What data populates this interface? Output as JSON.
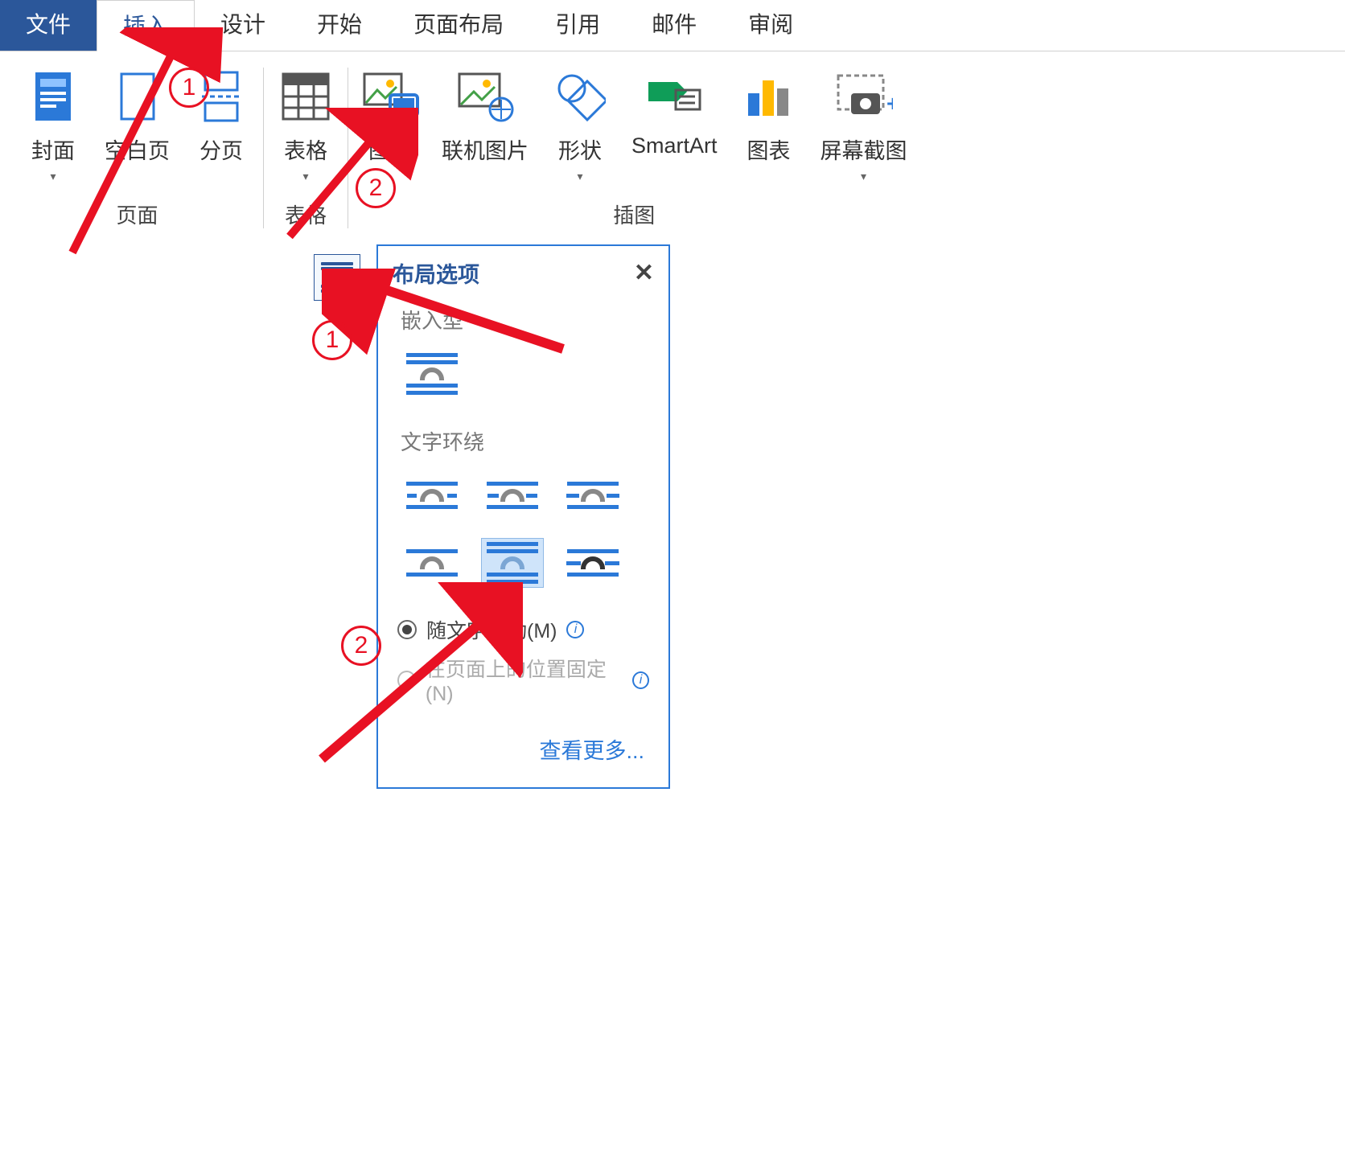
{
  "tabs": {
    "file": "文件",
    "insert": "插入",
    "design": "设计",
    "home": "开始",
    "pagelayout": "页面布局",
    "references": "引用",
    "mailings": "邮件",
    "review": "审阅"
  },
  "ribbon": {
    "groups": {
      "pages": {
        "label": "页面",
        "cover": "封面",
        "blank": "空白页",
        "break": "分页"
      },
      "tables": {
        "label": "表格",
        "table": "表格"
      },
      "illustrations": {
        "label": "插图",
        "picture": "图片",
        "online": "联机图片",
        "shapes": "形状",
        "smartart": "SmartArt",
        "chart": "图表",
        "screenshot": "屏幕截图"
      }
    }
  },
  "layoutPopup": {
    "title": "布局选项",
    "sectionInline": "嵌入型",
    "sectionWrap": "文字环绕",
    "radioMove": "随文字移动(M)",
    "radioFix": "在页面上的位置固定(N)",
    "seeMore": "查看更多..."
  },
  "annotations": {
    "top1": "1",
    "top2": "2",
    "bot1": "1",
    "bot2": "2"
  }
}
